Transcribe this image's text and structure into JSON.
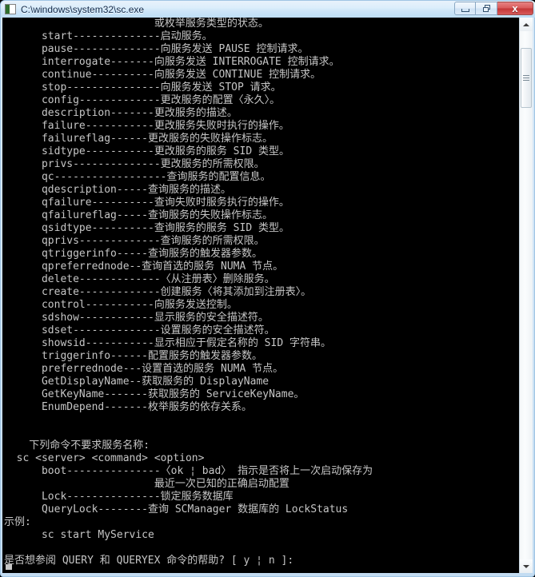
{
  "window": {
    "title": "C:\\windows\\system32\\sc.exe",
    "app_icon": "console-icon",
    "bg_color": "#000000",
    "text_color": "#c6c6c6",
    "titlebar_accent": "#cde5f8",
    "close_button_color": "#c33636"
  },
  "titlebar": {
    "minimize_label": "",
    "restore_label": "",
    "close_label": "x"
  },
  "scrollbar": {
    "up_arrow": "triangle-up",
    "down_arrow": "triangle-down",
    "thumb_position_pct": 3,
    "thumb_size_pct": 11
  },
  "console": {
    "lines": [
      "                        或枚举服务类型的状态。",
      "      start--------------启动服务。",
      "      pause--------------向服务发送 PAUSE 控制请求。",
      "      interrogate-------向服务发送 INTERROGATE 控制请求。",
      "      continue----------向服务发送 CONTINUE 控制请求。",
      "      stop---------------向服务发送 STOP 请求。",
      "      config-------------更改服务的配置〈永久〉。",
      "      description-------更改服务的描述。",
      "      failure-----------更改服务失败时执行的操作。",
      "      failureflag------更改服务的失败操作标志。",
      "      sidtype-----------更改服务的服务 SID 类型。",
      "      privs--------------更改服务的所需权限。",
      "      qc------------------查询服务的配置信息。",
      "      qdescription-----查询服务的描述。",
      "      qfailure----------查询失败时服务执行的操作。",
      "      qfailureflag-----查询服务的失败操作标志。",
      "      qsidtype----------查询服务的服务 SID 类型。",
      "      qprivs-------------查询服务的所需权限。",
      "      qtriggerinfo-----查询服务的触发器参数。",
      "      qpreferrednode--查询首选的服务 NUMA 节点。",
      "      delete-------------〈从注册表〉删除服务。",
      "      create-------------创建服务〈将其添加到注册表〉。",
      "      control-----------向服务发送控制。",
      "      sdshow------------显示服务的安全描述符。",
      "      sdset--------------设置服务的安全描述符。",
      "      showsid-----------显示相应于假定名称的 SID 字符串。",
      "      triggerinfo------配置服务的触发器参数。",
      "      preferrednode---设置首选的服务 NUMA 节点。",
      "      GetDisplayName--获取服务的 DisplayName",
      "      GetKeyName-------获取服务的 ServiceKeyName。",
      "      EnumDepend-------枚举服务的依存关系。",
      "",
      "",
      "    下列命令不要求服务名称:",
      "  sc <server> <command> <option>",
      "      boot---------------〈ok ¦ bad〉 指示是否将上一次启动保存为",
      "                        最近一次已知的正确启动配置",
      "      Lock---------------锁定服务数据库",
      "      QueryLock--------查询 SCManager 数据库的 LockStatus",
      "示例:",
      "      sc start MyService",
      "",
      "是否想参阅 QUERY 和 QUERYEX 命令的帮助? [ y ¦ n ]:"
    ],
    "caret": "block-cursor"
  }
}
